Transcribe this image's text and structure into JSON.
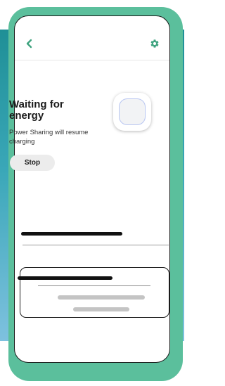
{
  "header": {
    "back_icon": "chevron-left-icon",
    "settings_icon": "gear-icon",
    "icon_color": "#3fa37f"
  },
  "status": {
    "title": "Waiting for energy",
    "subtitle": "Power Sharing will resume charging",
    "stop_label": "Stop"
  },
  "colors": {
    "phone_frame": "#5bbf9c",
    "backdrop_top": "#1f8f96",
    "backdrop_bottom": "#7ec1df",
    "accent": "#3fa37f"
  }
}
